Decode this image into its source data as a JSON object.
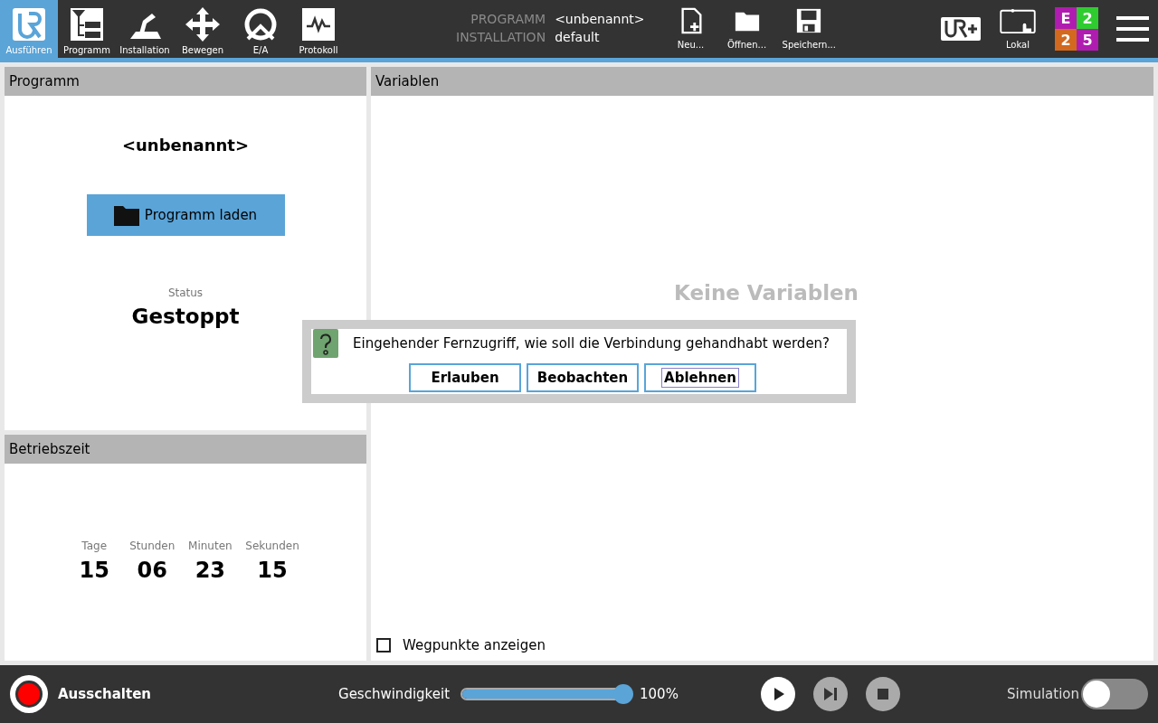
{
  "nav_tabs": [
    {
      "kind": "run",
      "label": "Ausführen",
      "selected": true
    },
    {
      "kind": "program",
      "label": "Programm",
      "selected": false
    },
    {
      "kind": "installation",
      "label": "Installation",
      "selected": false
    },
    {
      "kind": "move",
      "label": "Bewegen",
      "selected": false
    },
    {
      "kind": "io",
      "label": "E/A",
      "selected": false
    },
    {
      "kind": "log",
      "label": "Protokoll",
      "selected": false
    }
  ],
  "file_info": [
    {
      "label": "PROGRAMM",
      "value": "<unbenannt>"
    },
    {
      "label": "INSTALLATION",
      "value": "default"
    }
  ],
  "file_buttons": [
    {
      "kind": "new",
      "label": "Neu..."
    },
    {
      "kind": "open",
      "label": "Öffnen..."
    },
    {
      "kind": "save",
      "label": "Speichern..."
    }
  ],
  "mode": {
    "label": "Lokal"
  },
  "status_grid": [
    {
      "text": "E",
      "color": "#b01cb0"
    },
    {
      "text": "2",
      "color": "#2ecc2e"
    },
    {
      "text": "2",
      "color": "#d2691e"
    },
    {
      "text": "5",
      "color": "#b01cb0"
    }
  ],
  "program_panel": {
    "title": "Programm",
    "name": "<unbenannt>",
    "load_button": "Programm laden",
    "status_label": "Status",
    "status": "Gestoppt"
  },
  "uptime_panel": {
    "title": "Betriebszeit",
    "units": [
      {
        "label": "Tage",
        "value": "15"
      },
      {
        "label": "Stunden",
        "value": "06"
      },
      {
        "label": "Minuten",
        "value": "23"
      },
      {
        "label": "Sekunden",
        "value": "15"
      }
    ]
  },
  "variables_panel": {
    "title": "Variablen",
    "empty_text": "Keine Variablen",
    "show_waypoints": {
      "label": "Wegpunkte anzeigen",
      "checked": false
    }
  },
  "dialog": {
    "message": "Eingehender Fernzugriff, wie soll die Verbindung gehandhabt werden?",
    "buttons": [
      {
        "label": "Erlauben",
        "focused": false
      },
      {
        "label": "Beobachten",
        "focused": false
      },
      {
        "label": "Ablehnen",
        "focused": true
      }
    ]
  },
  "footer": {
    "power_label": "Ausschalten",
    "speed_label": "Geschwindigkeit",
    "speed": {
      "level": 1.0
    },
    "speed_reading": "100%",
    "controls": [
      {
        "kind": "play",
        "disabled": false
      },
      {
        "kind": "step",
        "disabled": true
      },
      {
        "kind": "stop",
        "disabled": true
      }
    ],
    "simulation": {
      "label": "Simulation",
      "on": false
    }
  }
}
